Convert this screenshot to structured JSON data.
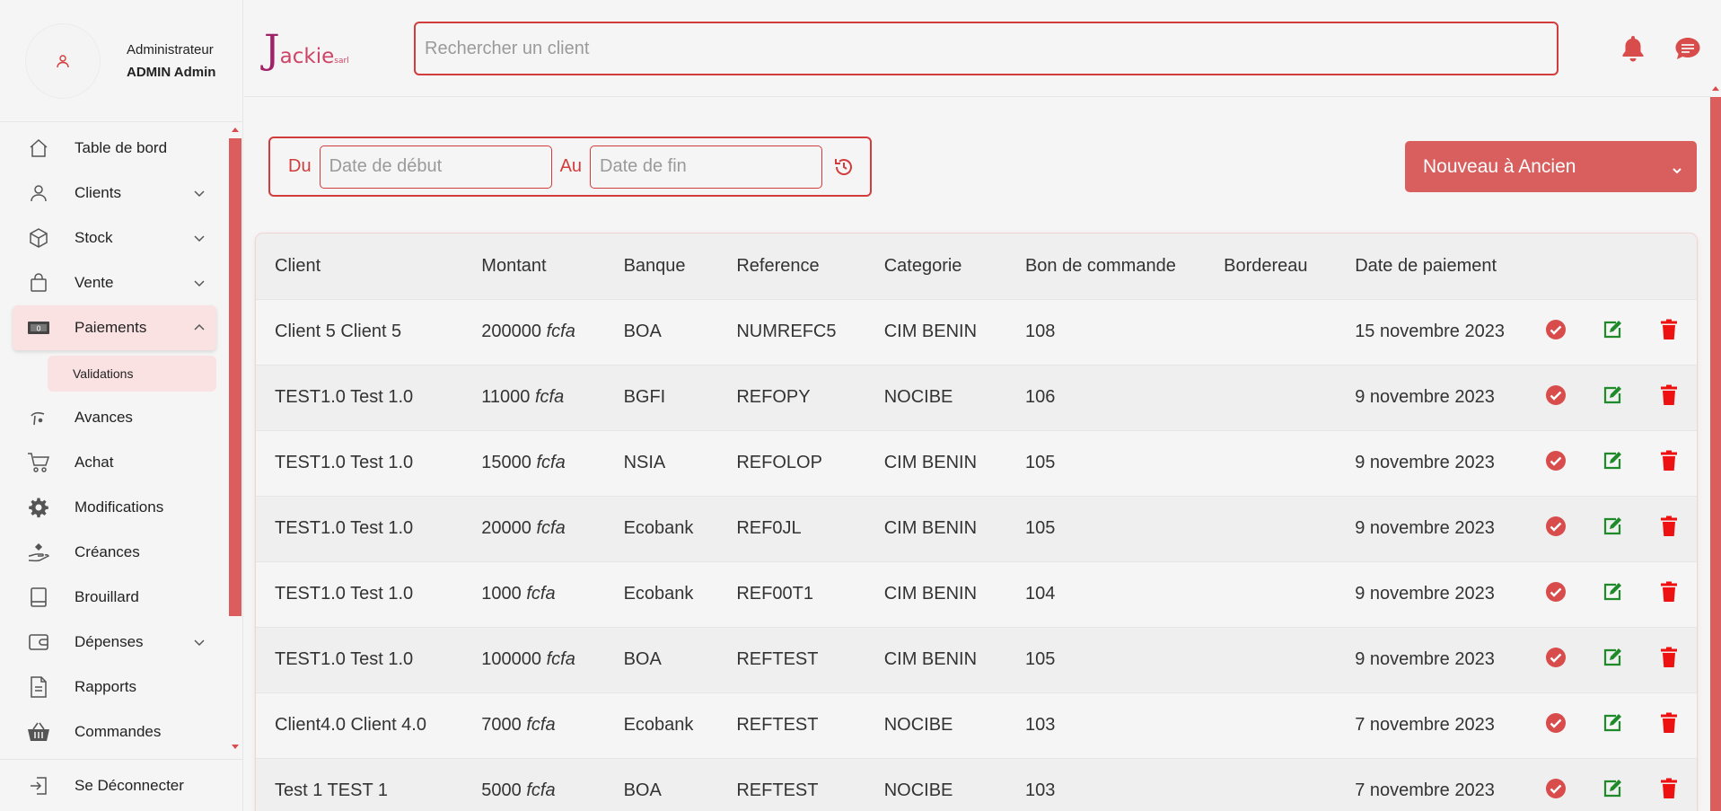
{
  "profile": {
    "role": "Administrateur",
    "name": "ADMIN Admin"
  },
  "logo": {
    "initial": "J",
    "rest": "ackie",
    "suffix": "sarl"
  },
  "search": {
    "placeholder": "Rechercher un client"
  },
  "sidebar": {
    "items": [
      {
        "label": "Table de bord",
        "icon": "home-icon"
      },
      {
        "label": "Clients",
        "icon": "user-icon",
        "has_submenu": true
      },
      {
        "label": "Stock",
        "icon": "box-icon",
        "has_submenu": true
      },
      {
        "label": "Vente",
        "icon": "shopping-bag-icon",
        "has_submenu": true
      },
      {
        "label": "Paiements",
        "icon": "money-icon",
        "has_submenu": true,
        "expanded": true
      },
      {
        "label": "Avances",
        "icon": "hand-coin-icon"
      },
      {
        "label": "Achat",
        "icon": "cart-icon"
      },
      {
        "label": "Modifications",
        "icon": "gear-icon"
      },
      {
        "label": "Créances",
        "icon": "hand-give-icon"
      },
      {
        "label": "Brouillard",
        "icon": "book-icon"
      },
      {
        "label": "Dépenses",
        "icon": "wallet-icon",
        "has_submenu": true
      },
      {
        "label": "Rapports",
        "icon": "file-icon"
      },
      {
        "label": "Commandes",
        "icon": "basket-icon"
      }
    ],
    "submenu": {
      "label": "Validations"
    },
    "logout": "Se Déconnecter"
  },
  "filter": {
    "from_label": "Du",
    "from_placeholder": "Date de début",
    "to_label": "Au",
    "to_placeholder": "Date de fin"
  },
  "sort": {
    "selected": "Nouveau à Ancien"
  },
  "table": {
    "columns": [
      "Client",
      "Montant",
      "Banque",
      "Reference",
      "Categorie",
      "Bon de commande",
      "Bordereau",
      "Date de paiement"
    ],
    "unit": "fcfa",
    "rows": [
      {
        "client": "Client 5 Client 5",
        "montant": "200000",
        "banque": "BOA",
        "reference": "NUMREFC5",
        "categorie": "CIM BENIN",
        "bon": "108",
        "bordereau": "",
        "date": "15 novembre 2023"
      },
      {
        "client": "TEST1.0 Test 1.0",
        "montant": "11000",
        "banque": "BGFI",
        "reference": "REFOPY",
        "categorie": "NOCIBE",
        "bon": "106",
        "bordereau": "",
        "date": "9 novembre 2023"
      },
      {
        "client": "TEST1.0 Test 1.0",
        "montant": "15000",
        "banque": "NSIA",
        "reference": "REFOLOP",
        "categorie": "CIM BENIN",
        "bon": "105",
        "bordereau": "",
        "date": "9 novembre 2023"
      },
      {
        "client": "TEST1.0 Test 1.0",
        "montant": "20000",
        "banque": "Ecobank",
        "reference": "REF0JL",
        "categorie": "CIM BENIN",
        "bon": "105",
        "bordereau": "",
        "date": "9 novembre 2023"
      },
      {
        "client": "TEST1.0 Test 1.0",
        "montant": "1000",
        "banque": "Ecobank",
        "reference": "REF00T1",
        "categorie": "CIM BENIN",
        "bon": "104",
        "bordereau": "",
        "date": "9 novembre 2023"
      },
      {
        "client": "TEST1.0 Test 1.0",
        "montant": "100000",
        "banque": "BOA",
        "reference": "REFTEST",
        "categorie": "CIM BENIN",
        "bon": "105",
        "bordereau": "",
        "date": "9 novembre 2023"
      },
      {
        "client": "Client4.0 Client 4.0",
        "montant": "7000",
        "banque": "Ecobank",
        "reference": "REFTEST",
        "categorie": "NOCIBE",
        "bon": "103",
        "bordereau": "",
        "date": "7 novembre 2023"
      },
      {
        "client": "Test 1 TEST 1",
        "montant": "5000",
        "banque": "BOA",
        "reference": "REFTEST",
        "categorie": "NOCIBE",
        "bon": "103",
        "bordereau": "",
        "date": "7 novembre 2023"
      }
    ]
  },
  "colors": {
    "accent": "#d23c3c",
    "accent_soft": "#fbe2e2",
    "validate": "#d94c4c",
    "edit": "#1f8a2a",
    "delete": "#ee1111"
  }
}
